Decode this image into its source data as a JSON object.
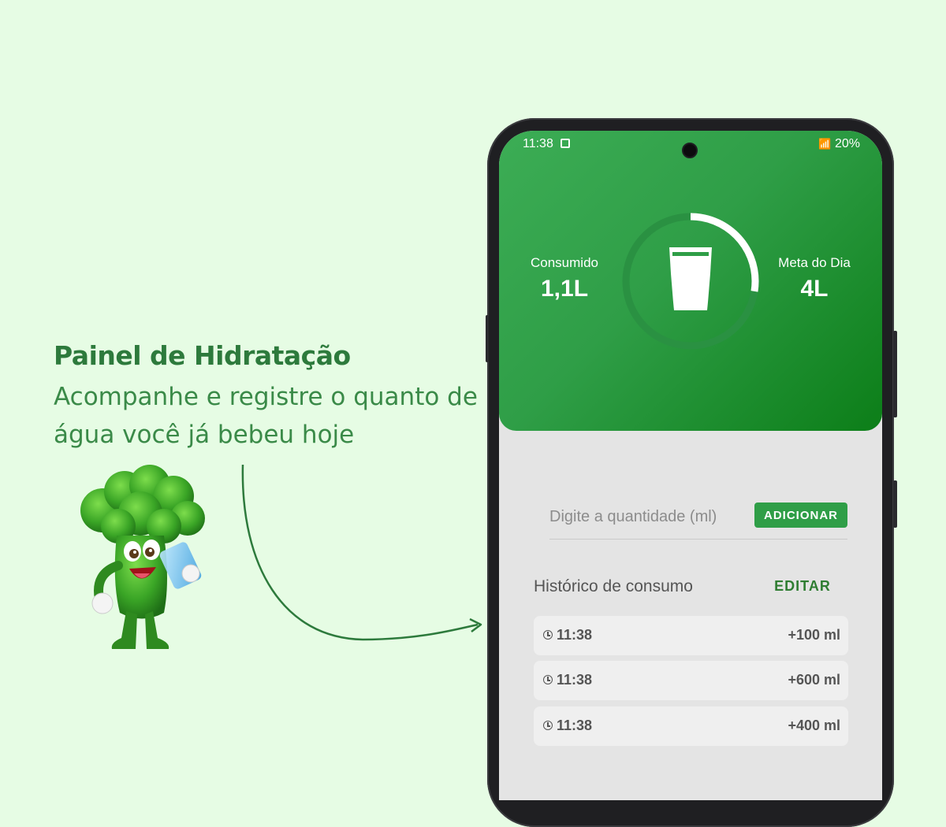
{
  "promo": {
    "title": "Painel de Hidratação",
    "subtitle": "Acompanhe e registre o quanto de água você já bebeu hoje"
  },
  "status_bar": {
    "time": "11:38",
    "battery": "20%"
  },
  "hydration": {
    "consumed_label": "Consumido",
    "consumed_value": "1,1L",
    "goal_label": "Meta do Dia",
    "goal_value": "4L",
    "progress_fraction": 0.275
  },
  "input": {
    "placeholder": "Digite a quantidade (ml)",
    "add_label": "ADICIONAR"
  },
  "history": {
    "title": "Histórico de consumo",
    "edit_label": "EDITAR",
    "entries": [
      {
        "time": "11:38",
        "amount": "+100 ml"
      },
      {
        "time": "11:38",
        "amount": "+600 ml"
      },
      {
        "time": "11:38",
        "amount": "+400 ml"
      }
    ]
  },
  "colors": {
    "background": "#e6fce4",
    "brand_green": "#2f9e47",
    "promo_text": "#2d7a3c"
  }
}
